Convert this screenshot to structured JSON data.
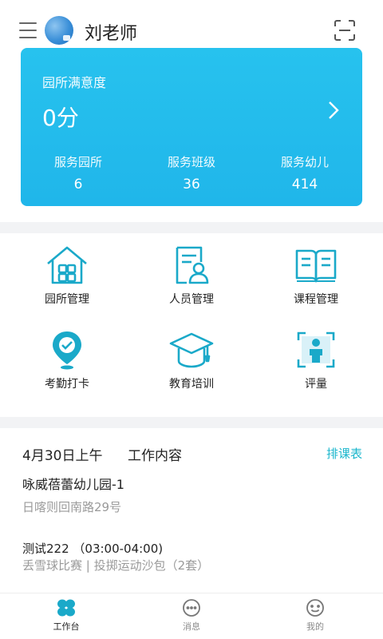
{
  "header": {
    "user_name": "刘老师"
  },
  "summary_card": {
    "title": "园所满意度",
    "score": "0分",
    "stats": [
      {
        "label": "服务园所",
        "value": "6"
      },
      {
        "label": "服务班级",
        "value": "36"
      },
      {
        "label": "服务幼儿",
        "value": "414"
      }
    ]
  },
  "features": [
    {
      "label": "园所管理",
      "icon": "school-house-icon"
    },
    {
      "label": "人员管理",
      "icon": "staff-card-icon"
    },
    {
      "label": "课程管理",
      "icon": "open-book-icon"
    },
    {
      "label": "考勤打卡",
      "icon": "location-check-icon"
    },
    {
      "label": "教育培训",
      "icon": "graduation-cap-icon"
    },
    {
      "label": "评量",
      "icon": "person-scan-icon"
    }
  ],
  "work": {
    "date": "4月30日上午",
    "title": "工作内容",
    "schedule_link": "排课表",
    "school_name": "咏威蓓蕾幼儿园-1",
    "school_address": "日喀则回南路29号",
    "course_title": "测试222 （03:00-04:00)",
    "course_desc": "丢雪球比赛 | 投掷运动沙包（2套）"
  },
  "tabbar": {
    "tabs": [
      {
        "label": "工作台",
        "icon": "workbench-icon",
        "active": true
      },
      {
        "label": "消息",
        "icon": "message-icon",
        "active": false
      },
      {
        "label": "我的",
        "icon": "profile-icon",
        "active": false
      }
    ]
  },
  "colors": {
    "accent": "#20b6ea",
    "icon_teal": "#1aa9c9",
    "link": "#19b6cc",
    "secondary_text": "#9a9a9a"
  }
}
